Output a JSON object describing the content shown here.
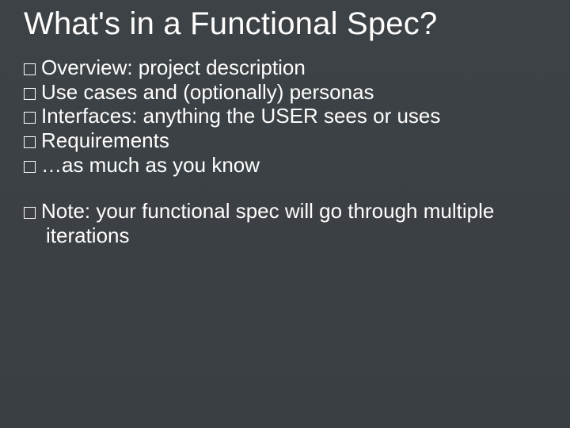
{
  "slide": {
    "title": "What's in a Functional Spec?",
    "bullets": {
      "b0": "Overview: project description",
      "b1": "Use cases and (optionally) personas",
      "b2": "Interfaces: anything the USER sees or uses",
      "b3": "Requirements",
      "b4": "…as much as you know"
    },
    "note": "Note:  your functional spec will go through multiple iterations"
  }
}
